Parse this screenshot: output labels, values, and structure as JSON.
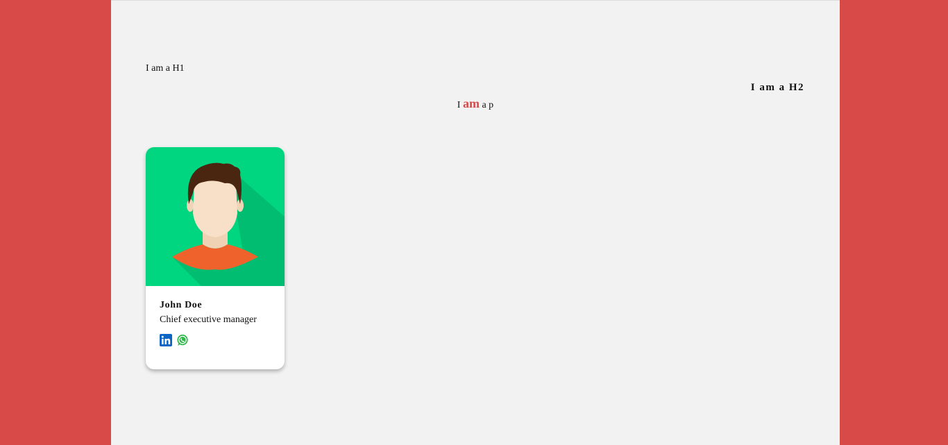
{
  "headings": {
    "h1": "I am a H1",
    "h2": "I am a H2"
  },
  "paragraph": {
    "before": "I ",
    "highlight": "am",
    "after": " a p"
  },
  "profile_card": {
    "name": "John Doe",
    "title": "Chief executive manager",
    "image_alt": "avatar",
    "social_icons": [
      "linkedin-icon",
      "whatsapp-icon"
    ]
  },
  "colors": {
    "background_red": "#d84a48",
    "content_bg": "#f2f2f2",
    "avatar_bg": "#00d57f",
    "linkedin_blue": "#0a66c2",
    "whatsapp_green": "#2fb84a",
    "shirt_orange": "#f0622c",
    "hair_brown": "#4a2510",
    "skin": "#f7e0c7"
  }
}
